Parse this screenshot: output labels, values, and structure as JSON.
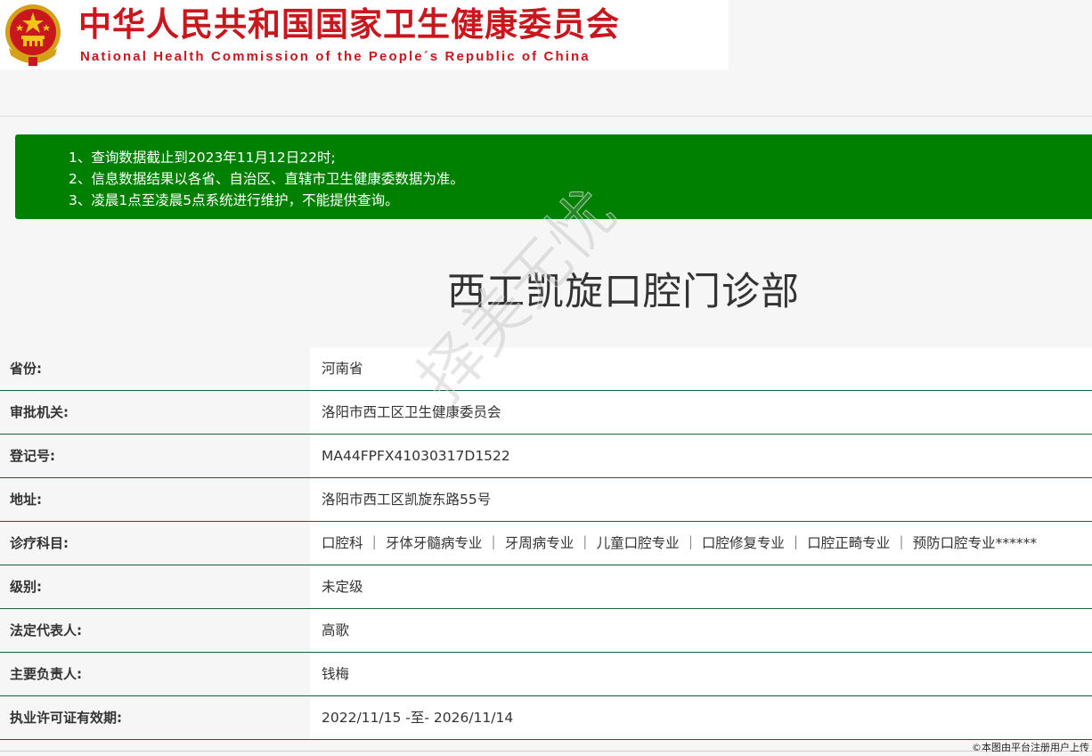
{
  "header": {
    "title_cn": "中华人民共和国国家卫生健康委员会",
    "title_en": "National Health Commission of the People´s Republic of China",
    "emblem_icon": "national-emblem-icon"
  },
  "notice": {
    "lines": [
      "1、查询数据截止到2023年11月12日22时;",
      "2、信息数据结果以各省、自治区、直辖市卫生健康委数据为准。",
      "3、凌晨1点至凌晨5点系统进行维护，不能提供查询。"
    ],
    "background_color": "#008000"
  },
  "institution": {
    "name": "西工凯旋口腔门诊部"
  },
  "details": [
    {
      "label": "省份:",
      "value": "河南省"
    },
    {
      "label": "审批机关:",
      "value": "洛阳市西工区卫生健康委员会"
    },
    {
      "label": "登记号:",
      "value": "MA44FPFX41030317D1522"
    },
    {
      "label": "地址:",
      "value": "洛阳市西工区凯旋东路55号"
    },
    {
      "label": "诊疗科目:",
      "value": "口腔科 ｜ 牙体牙髓病专业 ｜ 牙周病专业 ｜ 儿童口腔专业 ｜ 口腔修复专业 ｜ 口腔正畸专业 ｜ 预防口腔专业******"
    },
    {
      "label": "级别:",
      "value": "未定级"
    },
    {
      "label": "法定代表人:",
      "value": "高歌"
    },
    {
      "label": "主要负责人:",
      "value": "钱梅"
    },
    {
      "label": "执业许可证有效期:",
      "value": "2022/11/15 -至- 2026/11/14"
    }
  ],
  "watermark": "择美无忧",
  "corner_note": "©本图由平台注册用户上传",
  "colors": {
    "brand_red": "#c8181e",
    "notice_green": "#008000",
    "row_border": "#1d5e3a"
  }
}
